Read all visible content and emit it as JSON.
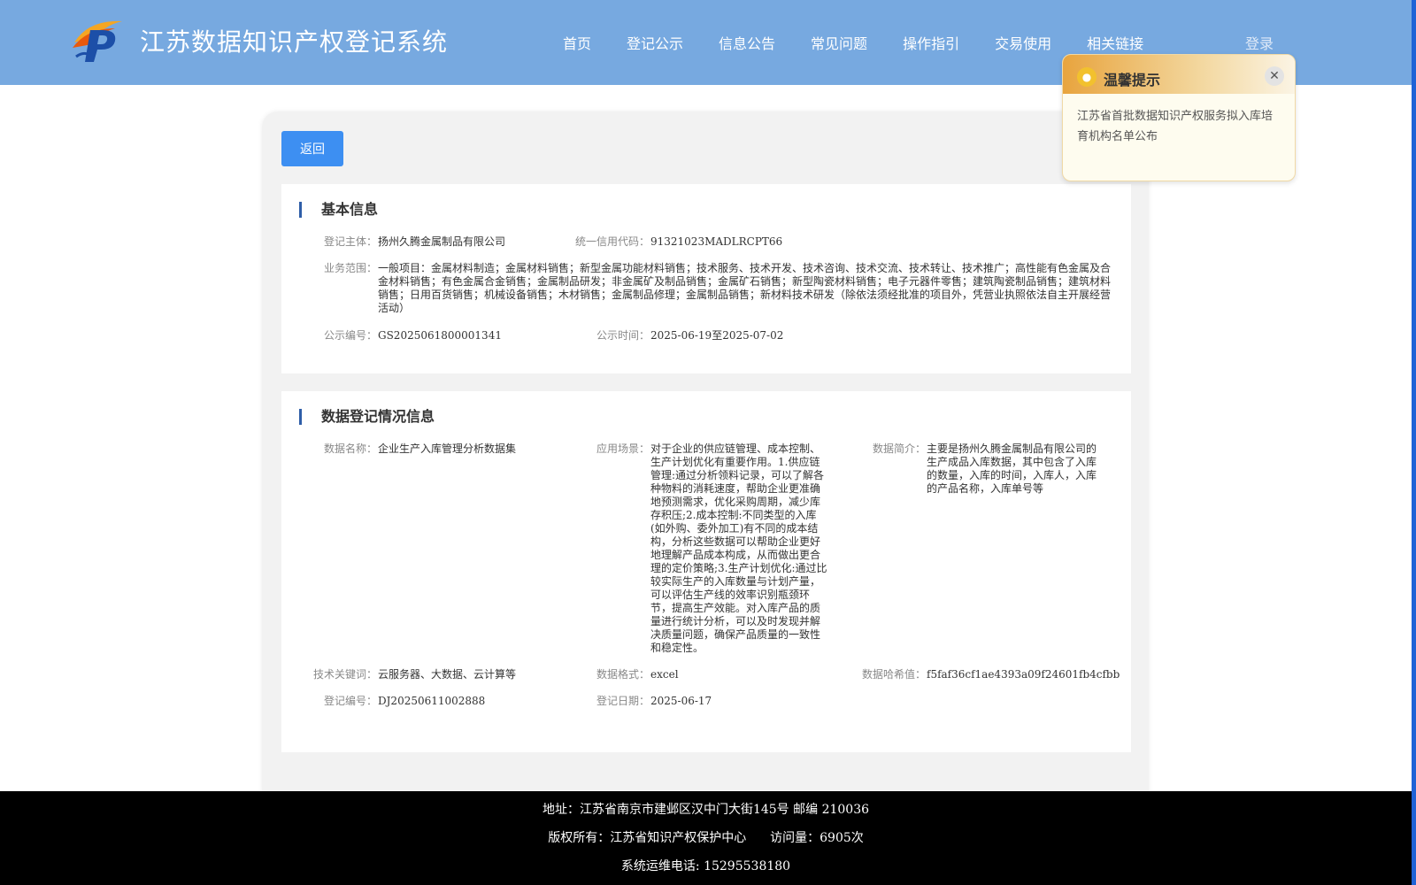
{
  "site": {
    "title": "江苏数据知识产权登记系统"
  },
  "nav": {
    "items": [
      "首页",
      "登记公示",
      "信息公告",
      "常见问题",
      "操作指引",
      "交易使用",
      "相关链接"
    ],
    "login": "登录"
  },
  "back_label": "返回",
  "basic": {
    "title": "基本信息",
    "subject_label": "登记主体：",
    "subject_value": "扬州久腾金属制品有限公司",
    "credit_label": "统一信用代码：",
    "credit_value": "91321023MADLRCPT66",
    "scope_label": "业务范围：",
    "scope_value": "一般项目：金属材料制造；金属材料销售；新型金属功能材料销售；技术服务、技术开发、技术咨询、技术交流、技术转让、技术推广；高性能有色金属及合金材料销售；有色金属合金销售；金属制品研发；非金属矿及制品销售；金属矿石销售；新型陶瓷材料销售；电子元器件零售；建筑陶瓷制品销售；建筑材料销售；日用百货销售；机械设备销售；木材销售；金属制品修理；金属制品销售；新材料技术研发（除依法须经批准的项目外，凭营业执照依法自主开展经营活动）",
    "pubno_label": "公示编号：",
    "pubno_value": "GS2025061800001341",
    "pubtime_label": "公示时间：",
    "pubtime_value": "2025-06-19至2025-07-02"
  },
  "data": {
    "title": "数据登记情况信息",
    "name_label": "数据名称：",
    "name_value": "企业生产入库管理分析数据集",
    "scene_label": "应用场景：",
    "scene_value": "对于企业的供应链管理、成本控制、生产计划优化有重要作用。1.供应链管理:通过分析领料记录，可以了解各种物料的消耗速度，帮助企业更准确地预测需求，优化采购周期，减少库存积压;2.成本控制:不同类型的入库(如外购、委外加工)有不同的成本结构，分析这些数据可以帮助企业更好地理解产品成本构成，从而做出更合理的定价策略;3.生产计划优化:通过比较实际生产的入库数量与计划产量，可以评估生产线的效率识别瓶颈环节，提高生产效能。对入库产品的质量进行统计分析，可以及时发现并解决质量问题，确保产品质量的一致性和稳定性。",
    "intro_label": "数据简介：",
    "intro_value": "主要是扬州久腾金属制品有限公司的生产成品入库数据，其中包含了入库的数量，入库的时间，入库人，入库的产品名称，入库单号等",
    "keywords_label": "技术关键词：",
    "keywords_value": "云服务器、大数据、云计算等",
    "format_label": "数据格式：",
    "format_value": "excel",
    "hash_label": "数据哈希值：",
    "hash_value": "f5faf36cf1ae4393a09f24601fb4cfbb",
    "regno_label": "登记编号：",
    "regno_value": "DJ20250611002888",
    "regdate_label": "登记日期：",
    "regdate_value": "2025-06-17"
  },
  "notice": {
    "title": "温馨提示",
    "body": "江苏省首批数据知识产权服务拟入库培育机构名单公布",
    "icon": "lightbulb-icon",
    "close_icon": "close-icon"
  },
  "footer": {
    "address": "地址：江苏省南京市建邺区汉中门大街145号 邮编 210036",
    "copyright": "版权所有：江苏省知识产权保护中心",
    "visits": "访问量：6905次",
    "phone": "系统运维电话: 15295538180"
  },
  "colors": {
    "header_bg": "#77a9e0",
    "primary_button": "#3d8ff2",
    "section_marker": "#2f5ea8",
    "footer_bg": "#000000"
  }
}
